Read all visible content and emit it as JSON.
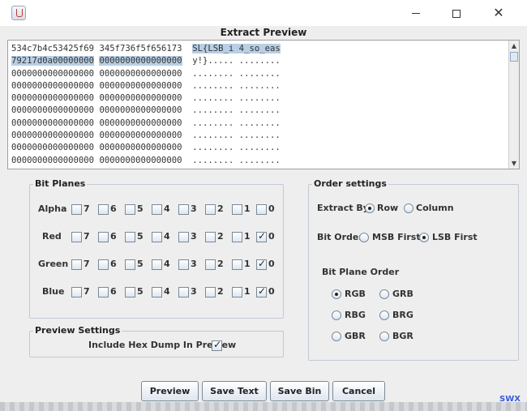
{
  "window": {
    "heading": "Extract Preview",
    "minimize": "",
    "maximize": "",
    "close": "✕"
  },
  "preview": {
    "hex_left": [
      "534c7b4c53425f69",
      "79217d0a00000000",
      "0000000000000000",
      "0000000000000000",
      "0000000000000000",
      "0000000000000000",
      "0000000000000000",
      "0000000000000000",
      "0000000000000000",
      "0000000000000000"
    ],
    "hex_right": [
      "345f736f5f656173",
      "0000000000000000",
      "0000000000000000",
      "0000000000000000",
      "0000000000000000",
      "0000000000000000",
      "0000000000000000",
      "0000000000000000",
      "0000000000000000",
      "0000000000000000"
    ],
    "ascii": [
      "SL{LSB_i 4_so_eas",
      "y!}..... ........",
      "........ ........",
      "........ ........",
      "........ ........",
      "........ ........",
      "........ ........",
      "........ ........",
      "........ ........",
      "........ ........"
    ]
  },
  "bit_planes": {
    "title": "Bit Planes",
    "bits": [
      "7",
      "6",
      "5",
      "4",
      "3",
      "2",
      "1",
      "0"
    ],
    "rows": [
      {
        "label": "Alpha",
        "checked": [
          false,
          false,
          false,
          false,
          false,
          false,
          false,
          false
        ]
      },
      {
        "label": "Red",
        "checked": [
          false,
          false,
          false,
          false,
          false,
          false,
          false,
          true
        ]
      },
      {
        "label": "Green",
        "checked": [
          false,
          false,
          false,
          false,
          false,
          false,
          false,
          true
        ]
      },
      {
        "label": "Blue",
        "checked": [
          false,
          false,
          false,
          false,
          false,
          false,
          false,
          true
        ]
      }
    ]
  },
  "preview_settings": {
    "title": "Preview Settings",
    "hexdump_label": "Include Hex Dump In Preview",
    "hexdump_checked": true
  },
  "order_settings": {
    "title": "Order settings",
    "extract_by_label": "Extract By",
    "extract_by_options": [
      "Row",
      "Column"
    ],
    "extract_by_selected": "Row",
    "bit_order_label": "Bit Order",
    "bit_order_options": [
      "MSB First",
      "LSB First"
    ],
    "bit_order_selected": "LSB First",
    "plane_order_label": "Bit Plane Order",
    "plane_order_options": [
      "RGB",
      "GRB",
      "RBG",
      "BRG",
      "GBR",
      "BGR"
    ],
    "plane_order_selected": "RGB"
  },
  "buttons": {
    "preview": "Preview",
    "save_text": "Save Text",
    "save_bin": "Save Bin",
    "cancel": "Cancel"
  },
  "footer": {
    "watermark": "SWX"
  }
}
